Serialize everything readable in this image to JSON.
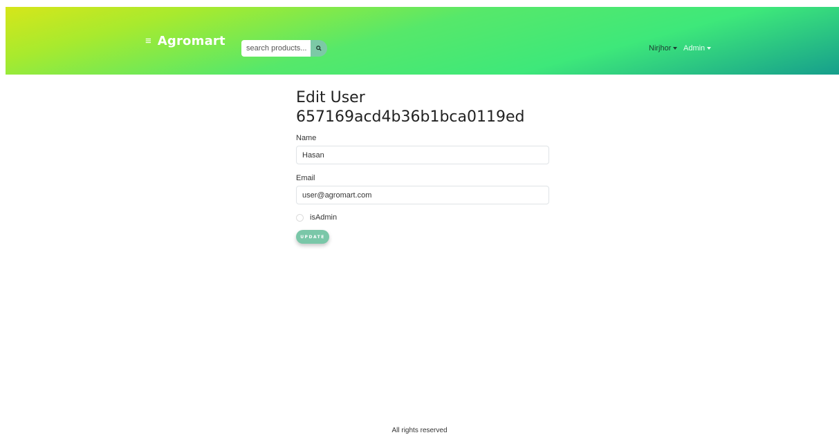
{
  "navbar": {
    "brand": "Agromart",
    "menu_icon": "hamburger-icon",
    "search": {
      "placeholder": "search products...",
      "icon": "search-icon"
    },
    "user_menu": "Nirjhor",
    "admin_menu": "Admin"
  },
  "page": {
    "title_line1": "Edit User",
    "title_line2": "657169acd4b36b1bca0119ed"
  },
  "form": {
    "name_label": "Name",
    "name_value": "Hasan",
    "email_label": "Email",
    "email_value": "user@agromart.com",
    "isadmin_label": "isAdmin",
    "isadmin_checked": false,
    "update_label": "UPDATE"
  },
  "footer": {
    "text": "All rights reserved"
  },
  "colors": {
    "accent": "#7ac7a8",
    "nav_gradient_start": "#d6e61a",
    "nav_gradient_end": "#169e8c"
  }
}
